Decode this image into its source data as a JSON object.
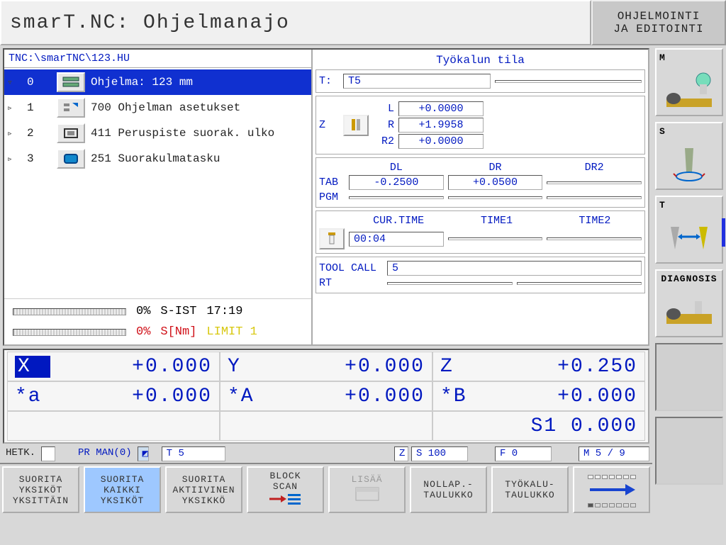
{
  "header": {
    "title": "smarT.NC: Ohjelmanajo",
    "mode_line1": "OHJELMOINTI",
    "mode_line2": "JA EDITOINTI"
  },
  "program": {
    "path": "TNC:\\smarTNC\\123.HU",
    "rows": [
      {
        "idx": "0",
        "label": "Ohjelma: 123 mm",
        "selected": true,
        "icon": "program"
      },
      {
        "idx": "1",
        "label": "700 Ohjelman asetukset",
        "selected": false,
        "icon": "settings"
      },
      {
        "idx": "2",
        "label": "411 Peruspiste suorak. ulko",
        "selected": false,
        "icon": "datum"
      },
      {
        "idx": "3",
        "label": "251 Suorakulmatasku",
        "selected": false,
        "icon": "pocket"
      }
    ]
  },
  "load_bars": {
    "line1_pct": "0%",
    "line1_lbl": "S-IST",
    "line1_time": "17:19",
    "line2_pct": "0%",
    "line2_lbl": "S[Nm]",
    "line2_limit": "LIMIT 1"
  },
  "tool_status": {
    "title": "Työkalun tila",
    "T_label": "T:",
    "T_value": "T5",
    "Z_label": "Z",
    "L_label": "L",
    "L_value": "+0.0000",
    "R_label": "R",
    "R_value": "+1.9958",
    "R2_label": "R2",
    "R2_value": "+0.0000",
    "DL_label": "DL",
    "DR_label": "DR",
    "DR2_label": "DR2",
    "TAB_label": "TAB",
    "TAB_DL": "-0.2500",
    "TAB_DR": "+0.0500",
    "TAB_DR2": "",
    "PGM_label": "PGM",
    "PGM_DL": "",
    "PGM_DR": "",
    "PGM_DR2": "",
    "CUR_label": "CUR.TIME",
    "TIME1_label": "TIME1",
    "TIME2_label": "TIME2",
    "CUR_value": "00:04",
    "TIME1_value": "",
    "TIME2_value": "",
    "TOOLCALL_label": "TOOL CALL",
    "TOOLCALL_value": "5",
    "RT_label": "RT",
    "RT_value": ""
  },
  "dro": {
    "X": {
      "axis": "X",
      "value": "+0.000"
    },
    "Y": {
      "axis": "Y",
      "value": "+0.000"
    },
    "Z": {
      "axis": "Z",
      "value": "+0.250"
    },
    "a": {
      "axis": "*a",
      "value": "+0.000"
    },
    "A": {
      "axis": "*A",
      "value": "+0.000"
    },
    "B": {
      "axis": "*B",
      "value": "+0.000"
    },
    "spindle": "S1  0.000"
  },
  "status": {
    "hetk": "HETK.",
    "pr": "PR MAN(0)",
    "t": "T 5",
    "z": "Z",
    "s": "S 100",
    "f": "F 0",
    "m": "M 5 / 9"
  },
  "softkeys": [
    {
      "l1": "SUORITA",
      "l2": "YKSIKÖT",
      "l3": "YKSITTÄIN",
      "active": false
    },
    {
      "l1": "SUORITA",
      "l2": "KAIKKI",
      "l3": "YKSIKÖT",
      "active": true
    },
    {
      "l1": "SUORITA",
      "l2": "AKTIIVINEN",
      "l3": "YKSIKKÖ",
      "active": false
    },
    {
      "l1": "BLOCK",
      "l2": "SCAN",
      "l3": "",
      "active": false,
      "icon": "block-scan"
    },
    {
      "l1": "LISÄÄ",
      "l2": "",
      "l3": "",
      "active": false,
      "dim": true,
      "icon": "lisaa"
    },
    {
      "l1": "NOLLAP.-",
      "l2": "TAULUKKO",
      "l3": "",
      "active": false
    },
    {
      "l1": "TYÖKALU-",
      "l2": "TAULUKKO",
      "l3": "",
      "active": false
    }
  ],
  "right_softkeys": [
    {
      "label": "M",
      "icon": "machine"
    },
    {
      "label": "S",
      "icon": "spindle"
    },
    {
      "label": "T",
      "icon": "tools",
      "active": true
    },
    {
      "label": "DIAGNOSIS",
      "icon": "diagnosis"
    },
    {
      "label": "",
      "icon": "",
      "empty": true
    },
    {
      "label": "",
      "icon": "",
      "empty": true
    }
  ]
}
